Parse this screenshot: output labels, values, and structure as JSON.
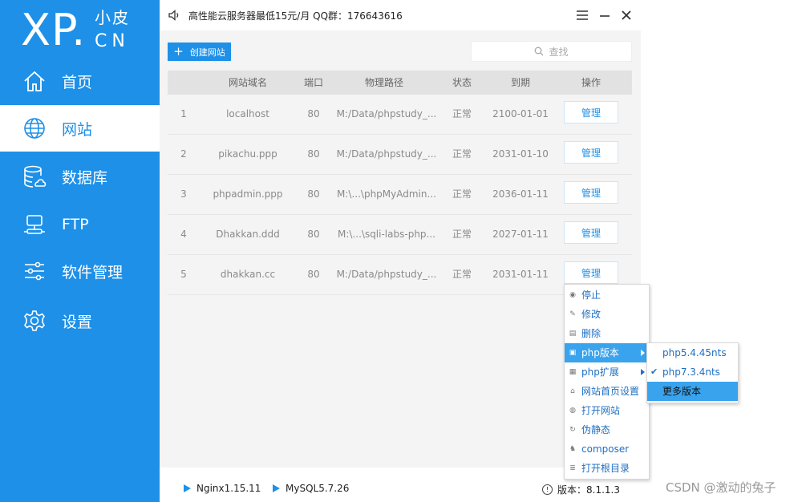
{
  "logo": {
    "mark": "XP.",
    "top": "小皮",
    "bottom": "CN"
  },
  "sidebar": {
    "items": [
      {
        "label": "首页",
        "icon": "home-icon"
      },
      {
        "label": "网站",
        "icon": "globe-icon",
        "active": true
      },
      {
        "label": "数据库",
        "icon": "database-icon"
      },
      {
        "label": "FTP",
        "icon": "server-icon"
      },
      {
        "label": "软件管理",
        "icon": "sliders-icon"
      },
      {
        "label": "设置",
        "icon": "gear-icon"
      }
    ]
  },
  "titlebar": {
    "ad": "高性能云服务器最低15元/月  QQ群：176643616"
  },
  "toolbar": {
    "create_label": "创建网站",
    "search_placeholder": "查找"
  },
  "table": {
    "headers": [
      "网站域名",
      "端口",
      "物理路径",
      "状态",
      "到期",
      "操作"
    ],
    "rows": [
      {
        "idx": "1",
        "domain": "localhost",
        "port": "80",
        "path": "M:/Data/phpstudy_...",
        "status": "正常",
        "expire": "2100-01-01",
        "action": "管理"
      },
      {
        "idx": "2",
        "domain": "pikachu.ppp",
        "port": "80",
        "path": "M:/Data/phpstudy_...",
        "status": "正常",
        "expire": "2031-01-10",
        "action": "管理"
      },
      {
        "idx": "3",
        "domain": "phpadmin.ppp",
        "port": "80",
        "path": "M:\\...\\phpMyAdmin...",
        "status": "正常",
        "expire": "2036-01-11",
        "action": "管理"
      },
      {
        "idx": "4",
        "domain": "Dhakkan.ddd",
        "port": "80",
        "path": "M:\\...\\sqli-labs-php...",
        "status": "正常",
        "expire": "2027-01-11",
        "action": "管理"
      },
      {
        "idx": "5",
        "domain": "dhakkan.cc",
        "port": "80",
        "path": "M:/Data/phpstudy_...",
        "status": "正常",
        "expire": "2031-01-11",
        "action": "管理"
      }
    ]
  },
  "context_menu": {
    "items": [
      {
        "label": "停止",
        "icon": "stop-icon"
      },
      {
        "label": "修改",
        "icon": "edit-icon"
      },
      {
        "label": "删除",
        "icon": "trash-icon"
      },
      {
        "label": "php版本",
        "icon": "php-icon",
        "highlighted": true,
        "submenu": true
      },
      {
        "label": "php扩展",
        "icon": "extension-icon",
        "submenu": true
      },
      {
        "label": "网站首页设置",
        "icon": "home-icon"
      },
      {
        "label": "打开网站",
        "icon": "globe-icon"
      },
      {
        "label": "伪静态",
        "icon": "refresh-icon"
      },
      {
        "label": "composer",
        "icon": "composer-icon"
      },
      {
        "label": "打开根目录",
        "icon": "list-icon"
      }
    ]
  },
  "php_submenu": {
    "items": [
      {
        "label": "php5.4.45nts",
        "checked": false
      },
      {
        "label": "php7.3.4nts",
        "checked": true
      },
      {
        "label": "更多版本",
        "highlighted": true
      }
    ]
  },
  "statusbar": {
    "nginx": "Nginx1.15.11",
    "mysql": "MySQL5.7.26",
    "version": "版本：8.1.1.3"
  },
  "watermark": "CSDN @激动的兔子",
  "colors": {
    "accent": "#1e90e8",
    "menu_highlight": "#3aa3ee"
  }
}
